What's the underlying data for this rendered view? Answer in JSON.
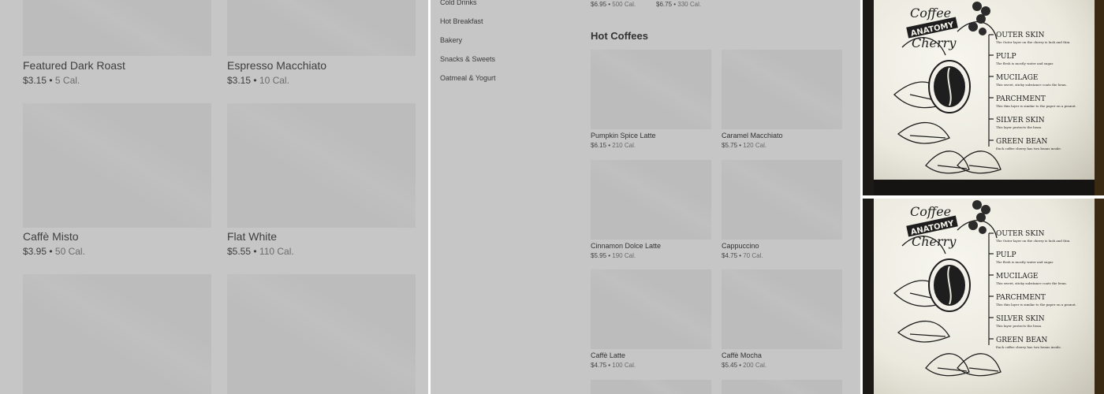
{
  "panel1": {
    "items": [
      {
        "name": "Featured Dark Roast",
        "price": "$3.15",
        "cal": "5 Cal."
      },
      {
        "name": "Espresso Macchiato",
        "price": "$3.15",
        "cal": "10 Cal."
      },
      {
        "name": "Caffè Misto",
        "price": "$3.95",
        "cal": "50 Cal."
      },
      {
        "name": "Flat White",
        "price": "$5.55",
        "cal": "110 Cal."
      }
    ]
  },
  "panel2": {
    "categories": [
      "Cold Drinks",
      "Hot Breakfast",
      "Bakery",
      "Snacks & Sweets",
      "Oatmeal & Yogurt"
    ],
    "top_meta": [
      {
        "price": "$6.95",
        "cal": "500 Cal."
      },
      {
        "price": "$6.75",
        "cal": "330 Cal."
      }
    ],
    "section_title": "Hot Coffees",
    "items": [
      {
        "name": "Pumpkin Spice Latte",
        "price": "$6.15",
        "cal": "210 Cal."
      },
      {
        "name": "Caramel Macchiato",
        "price": "$5.75",
        "cal": "120 Cal."
      },
      {
        "name": "Cinnamon Dolce Latte",
        "price": "$5.95",
        "cal": "190 Cal."
      },
      {
        "name": "Cappuccino",
        "price": "$4.75",
        "cal": "70 Cal."
      },
      {
        "name": "Caffè Latte",
        "price": "$4.75",
        "cal": "100 Cal."
      },
      {
        "name": "Caffè Mocha",
        "price": "$5.45",
        "cal": "200 Cal."
      }
    ]
  },
  "poster": {
    "title_line1": "Coffee",
    "title_banner": "ANATOMY",
    "title_line3": "Cherry",
    "layers": [
      {
        "name": "OUTER SKIN",
        "desc": "The Outer layer on the cherry is lush and thin."
      },
      {
        "name": "PULP",
        "desc": "The flesh is mostly water and sugar."
      },
      {
        "name": "MUCILAGE",
        "desc": "This sweet, sticky substance coats the bean."
      },
      {
        "name": "PARCHMENT",
        "desc": "This thin layer is similar to the paper on a peanut."
      },
      {
        "name": "SILVER SKIN",
        "desc": "This layer protects the bean."
      },
      {
        "name": "GREEN BEAN",
        "desc": "Each coffee cherry has two beans inside."
      }
    ]
  },
  "sep": " • "
}
